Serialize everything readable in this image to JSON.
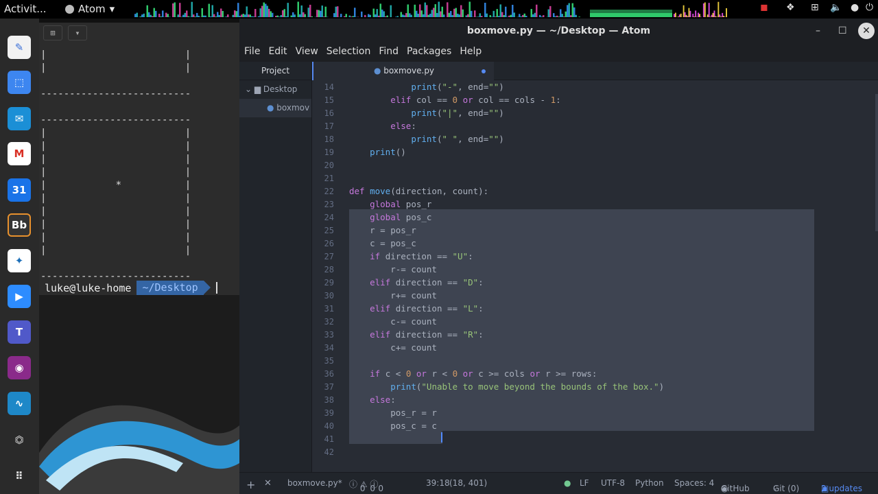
{
  "topbar": {
    "activities": "Activit...",
    "app": "Atom"
  },
  "terminal": {
    "header_icon": "new-tab-icon",
    "box": [
      "|                        |",
      "|                        |",
      "",
      "--------------------------",
      "",
      "--------------------------",
      "|                        |",
      "|                        |",
      "|                        |",
      "|                        |",
      "|            *           |",
      "|                        |",
      "|                        |",
      "|                        |",
      "|                        |",
      "|                        |",
      "",
      "--------------------------"
    ],
    "prompt_user": "luke@luke-home",
    "prompt_path": "~/Desktop"
  },
  "atom": {
    "title": "boxmove.py — ~/Desktop — Atom",
    "menu": [
      "File",
      "Edit",
      "View",
      "Selection",
      "Find",
      "Packages",
      "Help"
    ],
    "tree": {
      "header": "Project",
      "folder": "Desktop",
      "file": "boxmov"
    },
    "tab": "boxmove.py",
    "status": {
      "file": "boxmove.py*",
      "errors": "0",
      "warnings": "0",
      "info": "0",
      "position": "39:18",
      "coords": "(18, 401)",
      "eol": "LF",
      "encoding": "UTF-8",
      "grammar": "Python",
      "spaces": "Spaces: 4",
      "github": "GitHub",
      "git": "Git (0)",
      "updates": "2 updates"
    }
  },
  "code": [
    {
      "n": "14",
      "t": "            print(\"-\", end=\"\")"
    },
    {
      "n": "15",
      "t": "        elif col == 0 or col == cols - 1:"
    },
    {
      "n": "16",
      "t": "            print(\"|\", end=\"\")"
    },
    {
      "n": "17",
      "t": "        else:"
    },
    {
      "n": "18",
      "t": "            print(\" \", end=\"\")"
    },
    {
      "n": "19",
      "t": "    print()"
    },
    {
      "n": "20",
      "t": ""
    },
    {
      "n": "21",
      "t": ""
    },
    {
      "n": "22",
      "t": "def move(direction, count):"
    },
    {
      "n": "23",
      "t": "    global pos_r"
    },
    {
      "n": "24",
      "t": "    global pos_c"
    },
    {
      "n": "25",
      "t": "    r = pos_r"
    },
    {
      "n": "26",
      "t": "    c = pos_c"
    },
    {
      "n": "27",
      "t": "    if direction == \"U\":"
    },
    {
      "n": "28",
      "t": "        r-= count"
    },
    {
      "n": "29",
      "t": "    elif direction == \"D\":"
    },
    {
      "n": "30",
      "t": "        r+= count"
    },
    {
      "n": "31",
      "t": "    elif direction == \"L\":"
    },
    {
      "n": "32",
      "t": "        c-= count"
    },
    {
      "n": "33",
      "t": "    elif direction == \"R\":"
    },
    {
      "n": "34",
      "t": "        c+= count"
    },
    {
      "n": "35",
      "t": ""
    },
    {
      "n": "36",
      "t": "    if c < 0 or r < 0 or c >= cols or r >= rows:"
    },
    {
      "n": "37",
      "t": "        print(\"Unable to move beyond the bounds of the box.\")"
    },
    {
      "n": "38",
      "t": "    else:"
    },
    {
      "n": "39",
      "t": "        pos_r = r"
    },
    {
      "n": "40",
      "t": "        pos_c = c"
    },
    {
      "n": "41",
      "t": ""
    },
    {
      "n": "42",
      "t": ""
    }
  ],
  "colors": {
    "accent": "#568af2",
    "bg": "#282c34",
    "keyword": "#c678dd",
    "function": "#61afef",
    "string": "#98c379",
    "number": "#d19a66"
  }
}
